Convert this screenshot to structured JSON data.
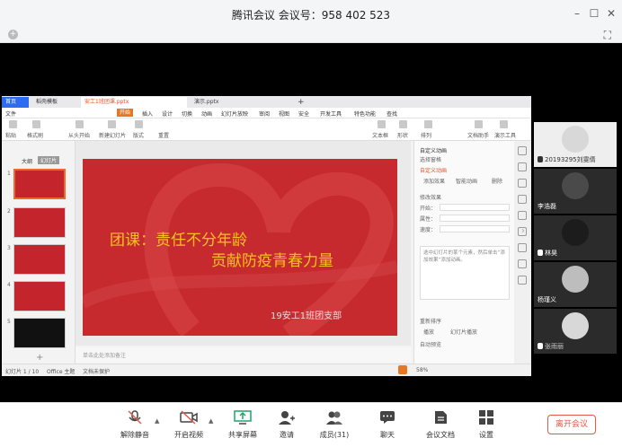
{
  "window": {
    "title": "腾讯会议 会议号：958 402 523",
    "minimize_label": "–",
    "maximize_label": "☐",
    "close_label": "✕",
    "settings_icon": "gear-icon",
    "fullscreen_icon": "fullscreen-icon"
  },
  "wps": {
    "tabs": [
      {
        "label": "首页"
      },
      {
        "label": "稻壳模板"
      },
      {
        "label": "安工1班团课.pptx"
      },
      {
        "label": "演示.pptx"
      },
      {
        "label": "+"
      }
    ],
    "menu": [
      "文件",
      "开始",
      "插入",
      "设计",
      "切换",
      "动画",
      "幻灯片放映",
      "审阅",
      "视图",
      "安全",
      "开发工具",
      "特色功能",
      "查找"
    ],
    "menu_active": "开始",
    "ribbon": [
      "粘贴",
      "格式刷",
      "从头开始",
      "新建幻灯片",
      "版式",
      "重置",
      "文本框",
      "形状",
      "排列",
      "文档助手",
      "演示工具"
    ],
    "sidebar_tabs": [
      "大纲",
      "幻灯片"
    ],
    "slide_numbers": [
      "1",
      "2",
      "3",
      "4",
      "5"
    ],
    "slide": {
      "line1": "团课：责任不分年龄",
      "line2": "贡献防疫青春力量",
      "footer": "19安工1班团支部"
    },
    "notes_placeholder": "单击此处添加备注",
    "status": {
      "slide_count": "幻灯片 1 / 10",
      "theme": "Office 主题",
      "protect": "文档未保护",
      "zoom": "58%"
    },
    "anim_panel": {
      "header": "自定义动画",
      "select_pane": "选择窗格",
      "custom_anim": "自定义动画",
      "add_effect": "添加效果",
      "smart_anim": "智能动画",
      "delete": "删除",
      "modify": "修改效果",
      "start": "开始：",
      "property": "属性：",
      "speed": "速度：",
      "hint": "选中幻灯片的某个元素，然后单击“添加效果”添加动画。",
      "reorder": "重新排序",
      "play": "播放",
      "slideshow": "幻灯片播放",
      "autopreview": "自动预览"
    }
  },
  "participants": [
    {
      "name": "20193295刘雯倩"
    },
    {
      "name": "李浩磊"
    },
    {
      "name": "林昊"
    },
    {
      "name": "杨瑾义"
    },
    {
      "name": "张雨丽"
    }
  ],
  "toolbar": {
    "mute_label": "解除静音",
    "video_label": "开启视频",
    "share_label": "共享屏幕",
    "invite_label": "邀请",
    "members_label": "成员(31)",
    "chat_label": "聊天",
    "docs_label": "会议文档",
    "settings_label": "设置",
    "leave_label": "离开会议"
  },
  "colors": {
    "slide_red": "#c72a2e",
    "title_yellow": "#f7c021",
    "leave_red": "#e35a45",
    "wps_orange": "#e87723",
    "home_blue": "#2d6bf0"
  }
}
